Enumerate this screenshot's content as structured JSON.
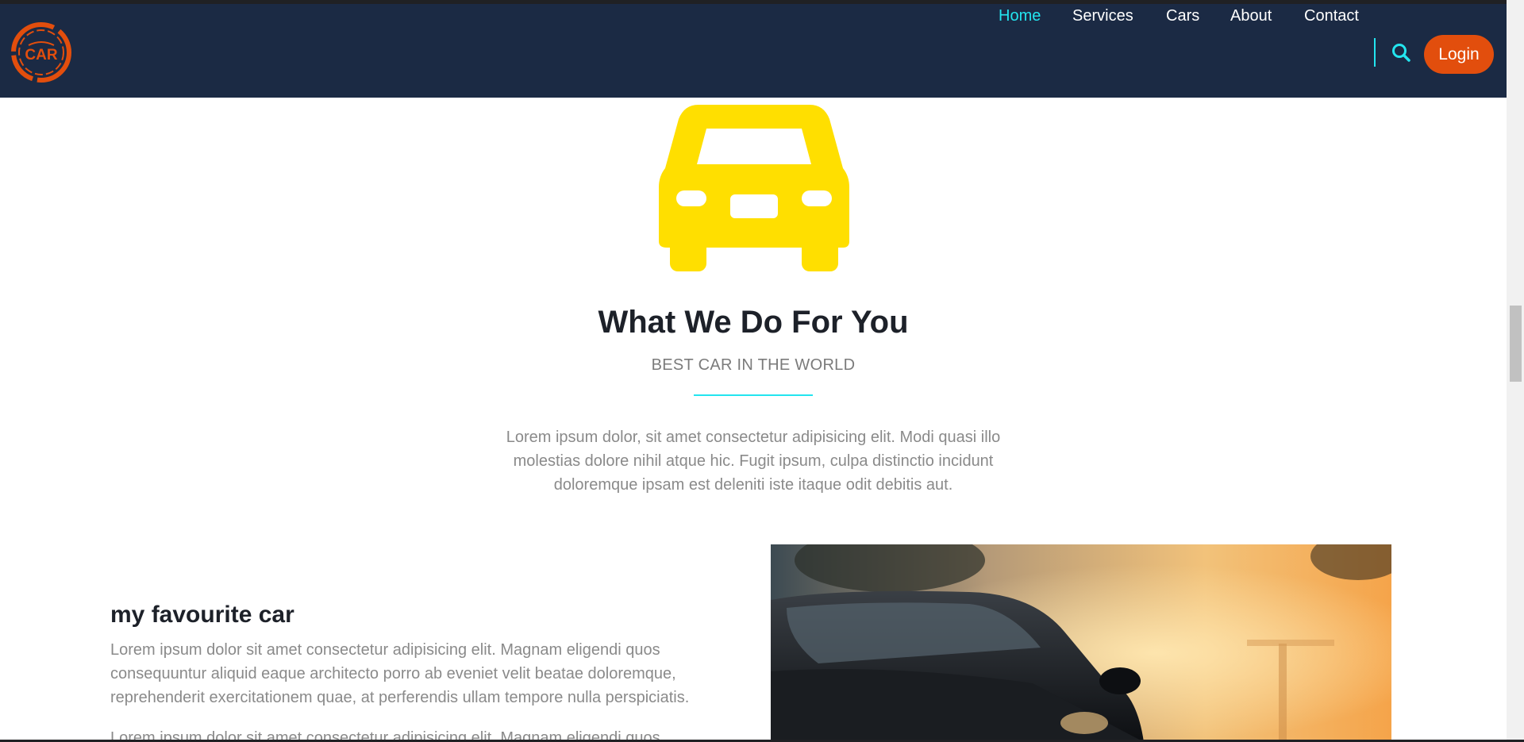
{
  "brand": {
    "logo_text": "CAR",
    "accent_color": "#e24e0d"
  },
  "nav": {
    "items": [
      {
        "label": "Home",
        "active": true
      },
      {
        "label": "Services",
        "active": false
      },
      {
        "label": "Cars",
        "active": false
      },
      {
        "label": "About",
        "active": false
      },
      {
        "label": "Contact",
        "active": false
      }
    ],
    "search_icon": "search-icon",
    "login_label": "Login",
    "bg_color": "#1b2a44",
    "active_color": "#23e5ef"
  },
  "hero": {
    "icon": "car-icon",
    "icon_color": "#ffdf00",
    "title": "What We Do For You",
    "subtitle": "BEST CAR IN THE WORLD",
    "text": "Lorem ipsum dolor, sit amet consectetur adipisicing elit. Modi quasi illo molestias dolore nihil atque hic. Fugit ipsum, culpa distinctio incidunt doloremque ipsam est deleniti iste itaque odit debitis aut."
  },
  "favourite": {
    "title": "my favourite car",
    "paragraph1": "Lorem ipsum dolor sit amet consectetur adipisicing elit. Magnam eligendi quos consequuntur aliquid eaque architecto porro ab eveniet velit beatae doloremque, reprehenderit exercitationem quae, at perferendis ullam tempore nulla perspiciatis.",
    "paragraph2": "Lorem ipsum dolor sit amet consectetur adipisicing elit. Magnam eligendi quos"
  }
}
